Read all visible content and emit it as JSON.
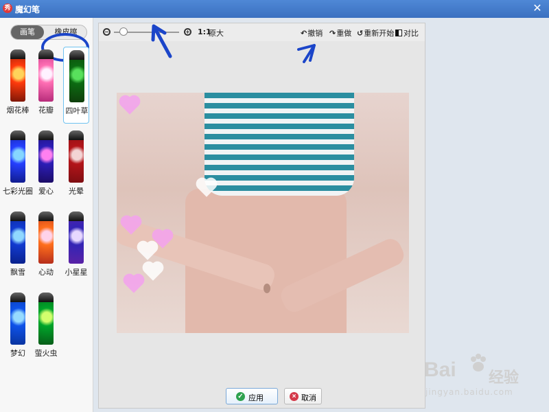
{
  "window": {
    "title": "魔幻笔",
    "app_icon_text": "秀"
  },
  "sidebar": {
    "tabs": [
      {
        "label": "画笔"
      },
      {
        "label": "橡皮擦"
      }
    ],
    "brushes": [
      {
        "label": "烟花棒",
        "colors": [
          "#ff3b0d",
          "#ffd35a",
          "#7a1606"
        ]
      },
      {
        "label": "花瓣",
        "colors": [
          "#ff6fb4",
          "#fff1ff",
          "#b32877"
        ]
      },
      {
        "label": "四叶草",
        "colors": [
          "#0c6b12",
          "#58e15c",
          "#0f3c0b"
        ],
        "selected": true
      },
      {
        "label": "七彩光圈",
        "colors": [
          "#2540ff",
          "#86d6ff",
          "#101a8a"
        ]
      },
      {
        "label": "爱心",
        "colors": [
          "#2c1eb7",
          "#ff80f0",
          "#1b0b63"
        ]
      },
      {
        "label": "光晕",
        "colors": [
          "#b3151a",
          "#f3d4d4",
          "#7c0d11"
        ]
      },
      {
        "label": "飘雪",
        "colors": [
          "#123bd0",
          "#90d8ff",
          "#09208a"
        ]
      },
      {
        "label": "心动",
        "colors": [
          "#ff6f1d",
          "#ffd3ea",
          "#b32b1b"
        ]
      },
      {
        "label": "小星星",
        "colors": [
          "#3324b5",
          "#e7d8ff",
          "#5b22a5"
        ]
      },
      {
        "label": "梦幻",
        "colors": [
          "#0e52e9",
          "#97dbff",
          "#09339d"
        ]
      },
      {
        "label": "萤火虫",
        "colors": [
          "#00a52a",
          "#d3ff6d",
          "#075b18"
        ]
      }
    ]
  },
  "toolbar": {
    "ratio": "1:1",
    "ratio_label": "原大",
    "undo": "撤销",
    "redo": "重做",
    "restart": "重新开始",
    "compare": "对比"
  },
  "footer": {
    "apply": "应用",
    "cancel": "取消"
  },
  "watermark": {
    "logo": "Bai",
    "logo_suffix": "经验",
    "url": "jingyan.baidu.com"
  },
  "colors": {
    "titlebar": "#3a70c0",
    "annotation": "#1b45c9"
  }
}
